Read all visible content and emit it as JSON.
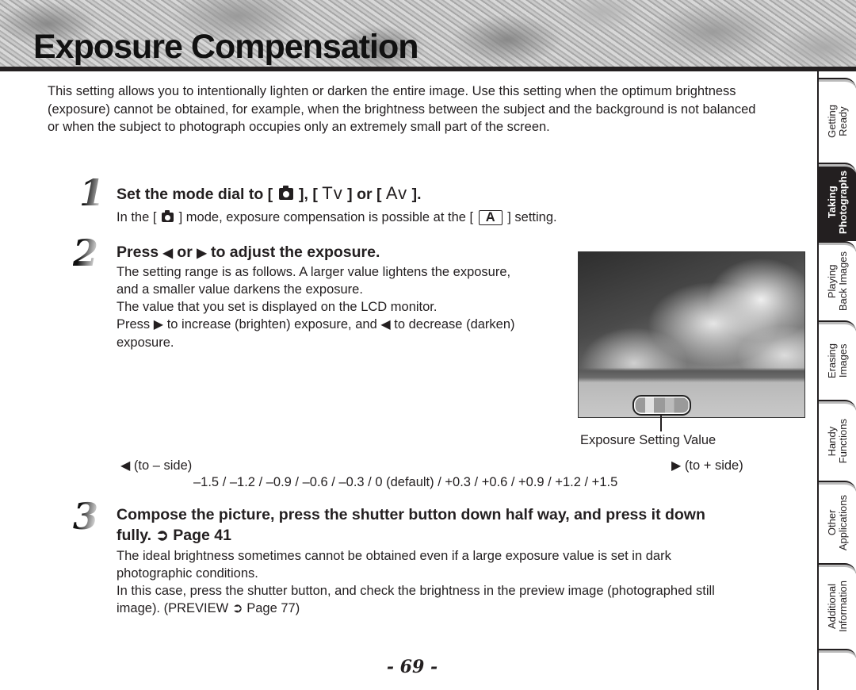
{
  "header": {
    "title": "Exposure Compensation"
  },
  "intro": "This setting allows you to intentionally lighten or darken the entire image. Use this setting when the optimum brightness (exposure) cannot be obtained, for example, when the brightness between the subject and the background is not balanced or when the subject to photograph occupies only an extremely small part of the screen.",
  "steps": [
    {
      "number": "1",
      "heading_prefix": "Set the mode dial to [",
      "heading_mid1": "], [",
      "mode_tv": "Tv",
      "heading_mid2": "] or [",
      "mode_av": "Av",
      "heading_suffix": "].",
      "body_prefix": "In the [",
      "body_mid": "] mode, exposure compensation is possible at the [",
      "body_mode_a": "A",
      "body_suffix": "] setting."
    },
    {
      "number": "2",
      "heading_prefix": "Press",
      "heading_left_arrow": "◀",
      "heading_or": "or",
      "heading_right_arrow": "▶",
      "heading_suffix": "to adjust the exposure.",
      "body_lines": [
        "The setting range is as follows. A larger value lightens the exposure,",
        "and a smaller value darkens the exposure.",
        "The value that you set is displayed on the LCD monitor."
      ],
      "body_press_prefix": "Press",
      "body_press_mid": "to increase (brighten) exposure, and",
      "body_press_suffix": "to decrease (darken)",
      "body_press_end": "exposure.",
      "figure_caption": "Exposure Setting Value",
      "range_minus_label": "(to – side)",
      "range_plus_label": "(to + side)",
      "range_values": "–1.5 / –1.2 / –0.9 / –0.6 / –0.3 / 0 (default) / +0.3 / +0.6 / +0.9 / +1.2 / +1.5"
    },
    {
      "number": "3",
      "heading_line1": "Compose the picture, press the shutter button down half way, and press it down",
      "heading_line2_prefix": "fully.",
      "heading_ref_icon": "➲",
      "heading_ref_page": "Page 41",
      "body_lines": [
        "The ideal brightness sometimes cannot be obtained even if a large exposure value is set in dark",
        "photographic conditions.",
        "In this case, press the shutter button, and check the brightness in the preview image (photographed still"
      ],
      "body_last_prefix": "image). (PREVIEW",
      "body_last_ref_icon": "➲",
      "body_last_suffix": "Page 77)"
    }
  ],
  "arrows": {
    "left": "◀",
    "right": "▶"
  },
  "sidebar": {
    "tabs": [
      {
        "label": "Getting\nReady",
        "active": false
      },
      {
        "label": "Taking\nPhotographs",
        "active": true
      },
      {
        "label": "Playing\nBack Images",
        "active": false
      },
      {
        "label": "Erasing\nImages",
        "active": false
      },
      {
        "label": "Handy\nFunctions",
        "active": false
      },
      {
        "label": "Other\nApplications",
        "active": false
      },
      {
        "label": "Additional\nInformation",
        "active": false
      }
    ]
  },
  "footer": {
    "page_number": "- 69 -"
  }
}
